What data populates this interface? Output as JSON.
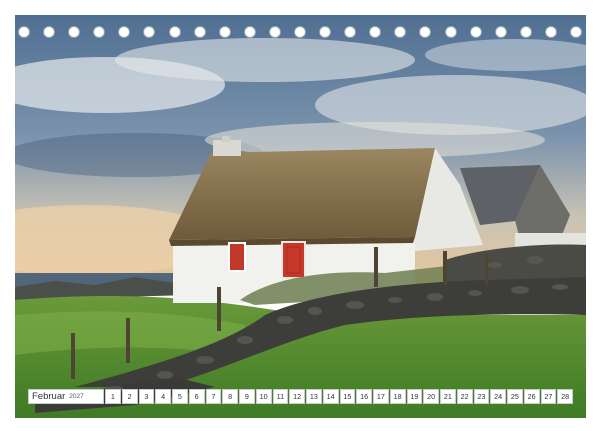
{
  "calendar": {
    "month": "Februar",
    "year": "2027",
    "days": [
      "1",
      "2",
      "3",
      "4",
      "5",
      "6",
      "7",
      "8",
      "9",
      "10",
      "11",
      "12",
      "13",
      "14",
      "15",
      "16",
      "17",
      "18",
      "19",
      "20",
      "21",
      "22",
      "23",
      "24",
      "25",
      "26",
      "27",
      "28"
    ]
  },
  "binding": {
    "hole_count": 23
  },
  "colors": {
    "sky_blue": "#5f7e9e",
    "cloud_light": "#dfe3e6",
    "sunset_glow": "#e9c79a",
    "thatch": "#8b7350",
    "wall_white": "#f1f1ee",
    "door_red": "#c0392b",
    "grass_green": "#4f8a2e",
    "stone_grey": "#3e3f3a"
  }
}
